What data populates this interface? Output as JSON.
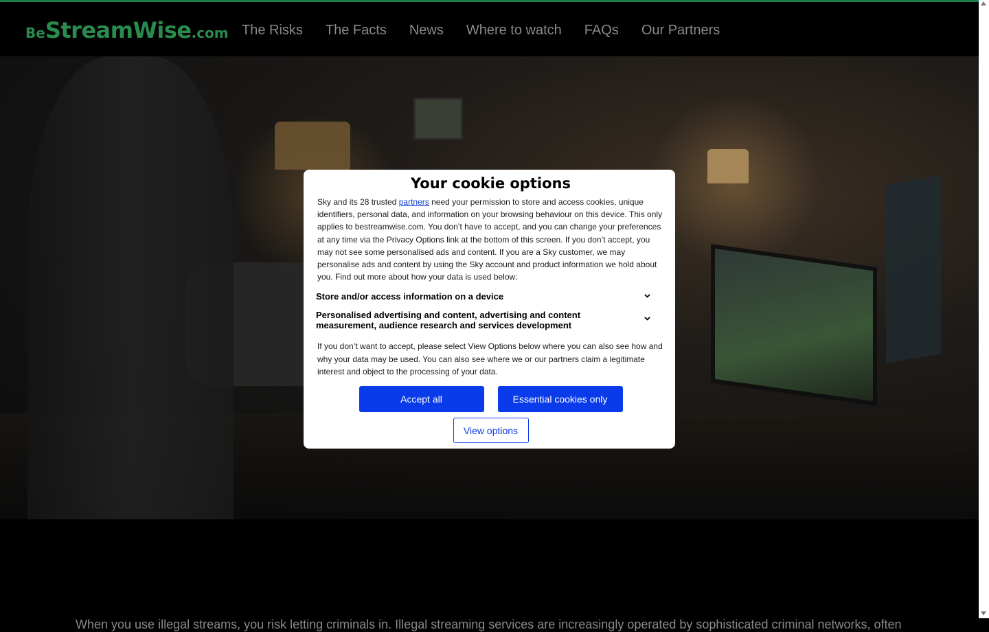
{
  "brand": {
    "logo_be": "Be",
    "logo_main": "StreamWise",
    "logo_com": ".com",
    "accent": "#1e7a46",
    "logo_color": "#2a8b4c"
  },
  "nav": {
    "items": [
      {
        "label": "The Risks"
      },
      {
        "label": "The Facts"
      },
      {
        "label": "News"
      },
      {
        "label": "Where to watch"
      },
      {
        "label": "FAQs"
      },
      {
        "label": "Our Partners"
      }
    ]
  },
  "intro_text": "When you use illegal streams, you risk letting criminals in. Illegal streaming services are increasingly operated by sophisticated criminal networks, often",
  "cookie_dialog": {
    "title": "Your cookie options",
    "body_before_link": "Sky and its 28 trusted ",
    "link_text": "partners",
    "body_after_link": " need your permission to store and access cookies, unique identifiers, personal data, and information on your browsing behaviour on this device. This only applies to bestreamwise.com. You don’t have to accept, and you can change your preferences at any time via the Privacy Options link at the bottom of this screen. If you don’t accept, you may not see some personalised ads and content.  If you are a Sky customer, we may personalise ads and content by using the Sky account and product information we hold about you. Find out more about how your data is used below:",
    "accordions": [
      {
        "label": "Store and/or access information on a device"
      },
      {
        "label": "Personalised advertising and content, advertising and content measurement, audience research and services development"
      }
    ],
    "body2": "If you don’t want to accept, please select View Options below where you can also see how and why your data may be used. You can also see where we or our partners claim a legitimate interest and object to the processing of your data.",
    "accept_label": "Accept all",
    "essential_label": "Essential cookies only",
    "view_label": "View options",
    "button_color": "#0a3bea"
  }
}
